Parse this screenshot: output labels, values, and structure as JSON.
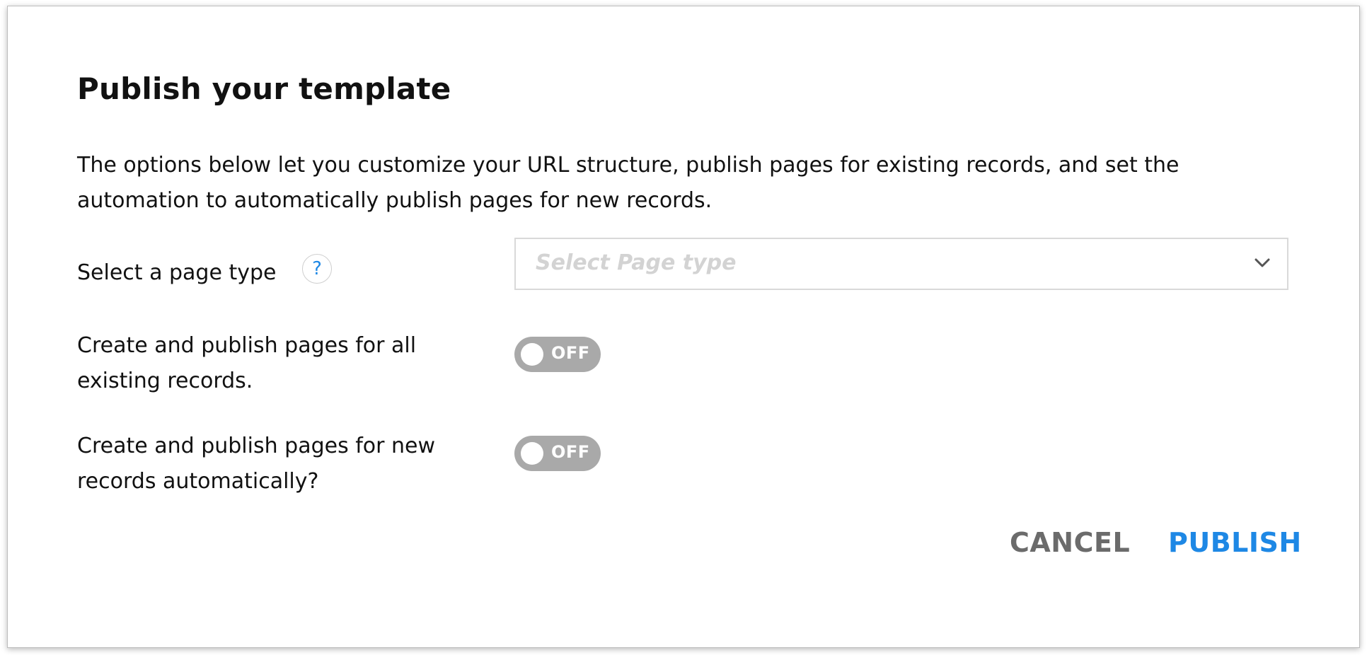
{
  "dialog": {
    "title": "Publish your template",
    "description": "The options below let you customize your URL structure, publish pages for existing records, and set the automation to automatically publish pages for new records."
  },
  "page_type": {
    "label": "Select a page type",
    "help_icon": "?",
    "placeholder": "Select Page type",
    "chevron_icon": "chevron-down-icon"
  },
  "existing_records": {
    "label_line1": "Create and publish pages for all",
    "label_line2": "existing records.",
    "toggle_state": "OFF"
  },
  "new_records": {
    "label_line1": "Create and publish pages for new",
    "label_line2": "records automatically?",
    "toggle_state": "OFF"
  },
  "actions": {
    "cancel_label": "CANCEL",
    "publish_label": "PUBLISH"
  },
  "colors": {
    "accent": "#1e88e5",
    "toggle_off": "#a9a9a9",
    "cancel_text": "#6b6b6b",
    "placeholder": "#d3d3d3"
  }
}
